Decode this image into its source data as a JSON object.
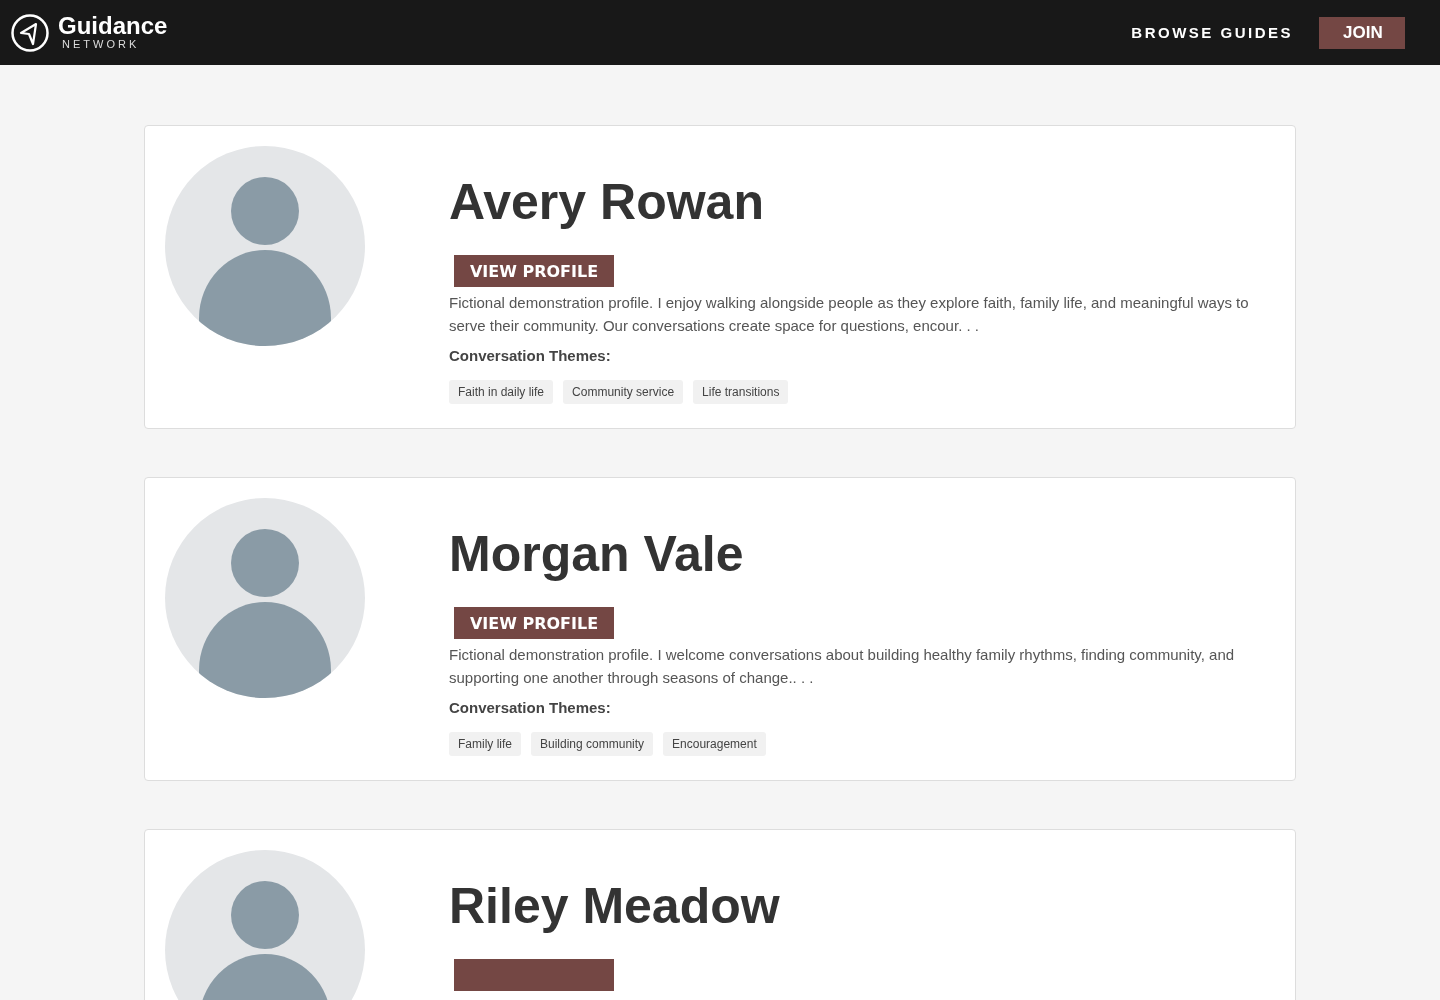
{
  "header": {
    "brand": "Guidance",
    "brand_sub": "NETWORK",
    "nav": [
      {
        "label": "BROWSE GUIDES",
        "kind": "link"
      },
      {
        "label": "JOIN",
        "kind": "button"
      }
    ]
  },
  "profiles": [
    {
      "name": "Avery Rowan",
      "button": "VIEW PROFILE",
      "description": "Fictional demonstration profile. I enjoy walking alongside people as they explore faith, family life, and meaningful ways to serve their community. Our conversations create space for questions, encour. . .",
      "themes_label": "Conversation Themes:",
      "themes": [
        "Faith in daily life",
        "Community service",
        "Life transitions"
      ]
    },
    {
      "name": "Morgan Vale",
      "button": "VIEW PROFILE",
      "description": "Fictional demonstration profile. I welcome conversations about building healthy family rhythms, finding community, and supporting one another through seasons of change.. . .",
      "themes_label": "Conversation Themes:",
      "themes": [
        "Family life",
        "Building community",
        "Encouragement"
      ]
    },
    {
      "name": "Riley Meadow"
    }
  ]
}
